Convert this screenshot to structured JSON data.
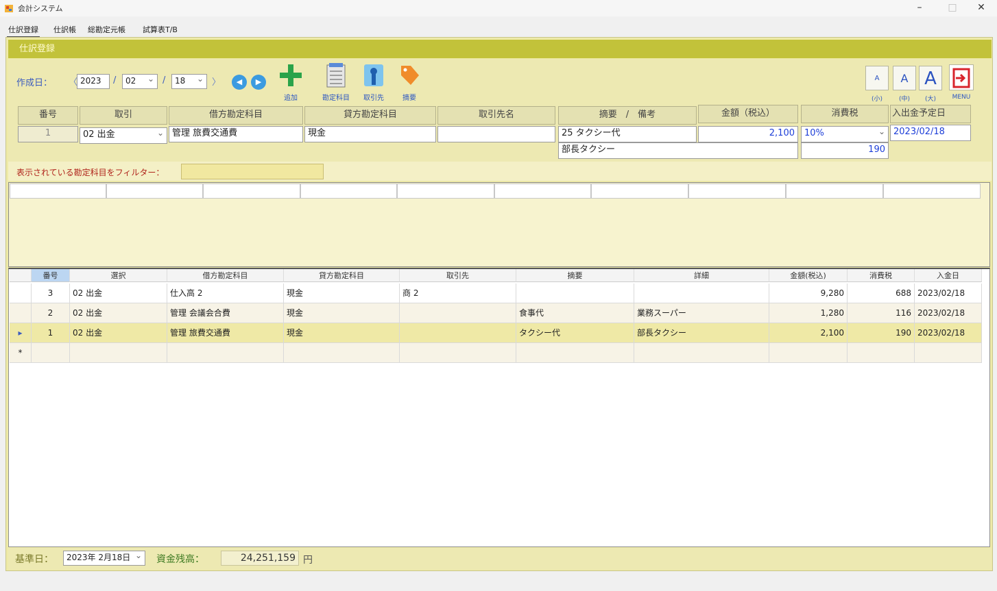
{
  "window": {
    "title": "会計システム",
    "minimize": "–",
    "maximize": "□",
    "close": "✕"
  },
  "menu_tabs": [
    "仕訳登録",
    "仕訳帳",
    "総勘定元帳",
    "試算表T/B"
  ],
  "form": {
    "title": "仕訳登録",
    "date_label": "作成日：",
    "date_year": "2023",
    "date_month": "02",
    "date_day": "18",
    "slash": "/",
    "prev_bracket": "〈",
    "next_bracket": "〉",
    "nav_prev": "◀",
    "nav_next": "▶",
    "tools": [
      {
        "label": "追加",
        "icon": "plus-icon"
      },
      {
        "label": "勘定科目",
        "icon": "list-icon"
      },
      {
        "label": "取引先",
        "icon": "partner-icon"
      },
      {
        "label": "摘要",
        "icon": "tag-icon"
      }
    ],
    "font_buttons": [
      {
        "glyph": "A",
        "label": "(小)"
      },
      {
        "glyph": "A",
        "label": "(中)"
      },
      {
        "glyph": "A",
        "label": "(大)"
      }
    ],
    "exit_label": "MENU"
  },
  "entry": {
    "headers": [
      "番号",
      "取引",
      "借方勘定科目",
      "貸方勘定科目",
      "取引先名",
      "摘要　/　備考",
      "金額（税込）",
      "消費税",
      "入出金予定日"
    ],
    "number": "1",
    "transaction": "02 出金",
    "debit": "管理 旅費交通費",
    "credit": "現金",
    "partner": "",
    "summary": "25 タクシー代",
    "remark": "部長タクシー",
    "amount": "2,100",
    "tax_rate": "10%",
    "tax_amount": "190",
    "due_date": "2023/02/18"
  },
  "filter": {
    "label": "表示されている勘定科目をフィルター：",
    "value": ""
  },
  "grid": {
    "headers": [
      "番号",
      "選択",
      "借方勘定科目",
      "貸方勘定科目",
      "取引先",
      "摘要",
      "詳細",
      "金額(税込)",
      "消費税",
      "入金日"
    ],
    "rows": [
      {
        "marker": "",
        "no": "3",
        "kind": "02 出金",
        "debit": "仕入高 2",
        "credit": "現金",
        "partner": "商 2",
        "summary": "",
        "detail": "",
        "amount": "9,280",
        "tax": "688",
        "date": "2023/02/18"
      },
      {
        "marker": "",
        "no": "2",
        "kind": "02 出金",
        "debit": "管理 会議会合費",
        "credit": "現金",
        "partner": "",
        "summary": "食事代",
        "detail": "業務スーパー",
        "amount": "1,280",
        "tax": "116",
        "date": "2023/02/18"
      },
      {
        "marker": "▸",
        "no": "1",
        "kind": "02 出金",
        "debit": "管理 旅費交通費",
        "credit": "現金",
        "partner": "",
        "summary": "タクシー代",
        "detail": "部長タクシー",
        "amount": "2,100",
        "tax": "190",
        "date": "2023/02/18"
      },
      {
        "marker": "*",
        "no": "",
        "kind": "",
        "debit": "",
        "credit": "",
        "partner": "",
        "summary": "",
        "detail": "",
        "amount": "",
        "tax": "",
        "date": ""
      }
    ]
  },
  "footer": {
    "base_date_label": "基準日：",
    "base_date": "2023年 2月18日",
    "balance_label": "資金残高：",
    "balance": "24,251,159",
    "yen": "円"
  },
  "colors": {
    "title_band": "#c2c23a",
    "panel": "#ede9b2",
    "accent_blue": "#2c56c2",
    "filter_red": "#b0241c",
    "selected_row": "#efe9a6"
  }
}
